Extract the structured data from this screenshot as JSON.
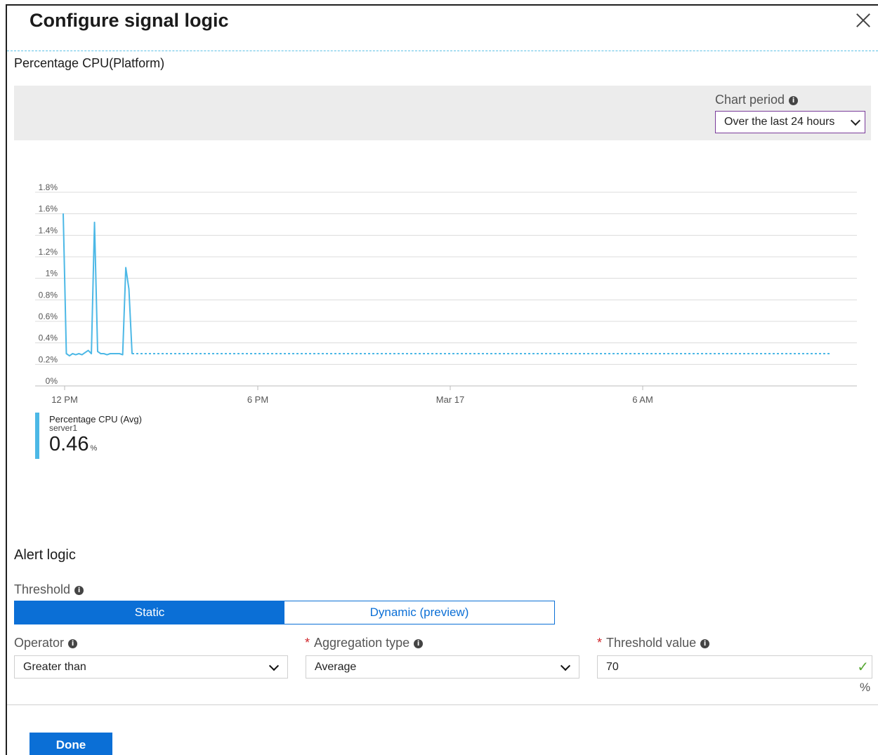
{
  "header": {
    "title": "Configure signal logic"
  },
  "metric": {
    "title": "Percentage CPU(Platform)"
  },
  "chart_period": {
    "label": "Chart period",
    "value": "Over the last 24 hours"
  },
  "chart_data": {
    "type": "line",
    "y_ticks": [
      "1.8%",
      "1.6%",
      "1.4%",
      "1.2%",
      "1%",
      "0.8%",
      "0.6%",
      "0.4%",
      "0.2%",
      "0%"
    ],
    "x_ticks": [
      "12 PM",
      "6 PM",
      "Mar 17",
      "6 AM"
    ],
    "ylim": [
      0,
      1.8
    ],
    "grid": true,
    "series": [
      {
        "name": "Percentage CPU (Avg)",
        "color": "#4cb8e6",
        "values": [
          1.6,
          0.3,
          0.28,
          0.3,
          0.29,
          0.3,
          0.29,
          0.31,
          0.33,
          0.3,
          1.52,
          0.32,
          0.3,
          0.3,
          0.29,
          0.3,
          0.3,
          0.3,
          0.3,
          0.29,
          1.1,
          0.9,
          0.3
        ],
        "projection_value": 0.3
      }
    ]
  },
  "legend": {
    "name": "Percentage CPU (Avg)",
    "resource": "server1",
    "value": "0.46",
    "unit": "%"
  },
  "alert_logic": {
    "title": "Alert logic",
    "threshold_label": "Threshold",
    "static_label": "Static",
    "dynamic_label": "Dynamic (preview)"
  },
  "fields": {
    "operator_label": "Operator",
    "operator_value": "Greater than",
    "aggregation_label": "Aggregation type",
    "aggregation_value": "Average",
    "threshold_value_label": "Threshold value",
    "threshold_value": "70",
    "unit": "%"
  },
  "done_label": "Done",
  "icons": {
    "info": "info-icon",
    "close": "close-icon",
    "check": "checkmark-icon"
  }
}
